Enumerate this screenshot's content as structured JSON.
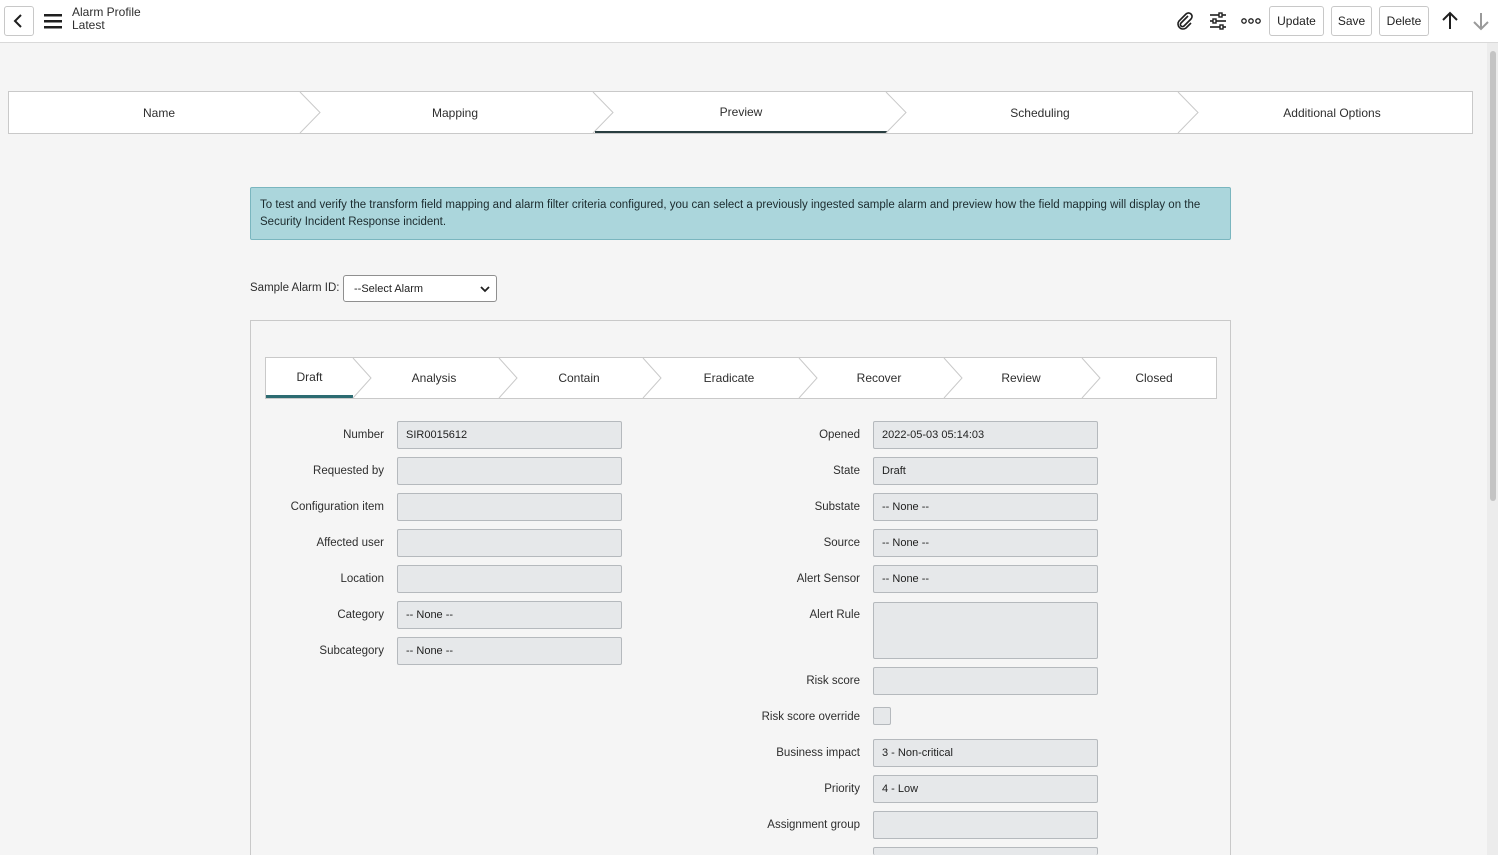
{
  "header": {
    "title": "Alarm Profile",
    "subtitle": "Latest",
    "buttons": {
      "update": "Update",
      "save": "Save",
      "delete": "Delete"
    }
  },
  "steps": [
    "Name",
    "Mapping",
    "Preview",
    "Scheduling",
    "Additional Options"
  ],
  "active_step": "Preview",
  "banner": "To test and verify the transform field mapping and alarm filter criteria configured, you can select a previously ingested sample alarm and preview how the field mapping will display on the Security Incident Response incident.",
  "sample": {
    "label": "Sample Alarm ID:",
    "value": "--Select Alarm"
  },
  "inner_steps": [
    "Draft",
    "Analysis",
    "Contain",
    "Eradicate",
    "Recover",
    "Review",
    "Closed"
  ],
  "active_inner_step": "Draft",
  "left_fields": [
    {
      "label": "Number",
      "value": "SIR0015612"
    },
    {
      "label": "Requested by",
      "value": ""
    },
    {
      "label": "Configuration item",
      "value": ""
    },
    {
      "label": "Affected user",
      "value": ""
    },
    {
      "label": "Location",
      "value": ""
    },
    {
      "label": "Category",
      "value": "-- None --"
    },
    {
      "label": "Subcategory",
      "value": "-- None --"
    }
  ],
  "right_fields": [
    {
      "label": "Opened",
      "value": "2022-05-03 05:14:03"
    },
    {
      "label": "State",
      "value": "Draft"
    },
    {
      "label": "Substate",
      "value": "-- None --"
    },
    {
      "label": "Source",
      "value": "-- None --"
    },
    {
      "label": "Alert Sensor",
      "value": "-- None --"
    },
    {
      "label": "Alert Rule",
      "value": ""
    },
    {
      "label": "Risk score",
      "value": ""
    },
    {
      "label": "Risk score override",
      "value": ""
    },
    {
      "label": "Business impact",
      "value": "3 - Non-critical"
    },
    {
      "label": "Priority",
      "value": "4 - Low"
    },
    {
      "label": "Assignment group",
      "value": ""
    }
  ]
}
